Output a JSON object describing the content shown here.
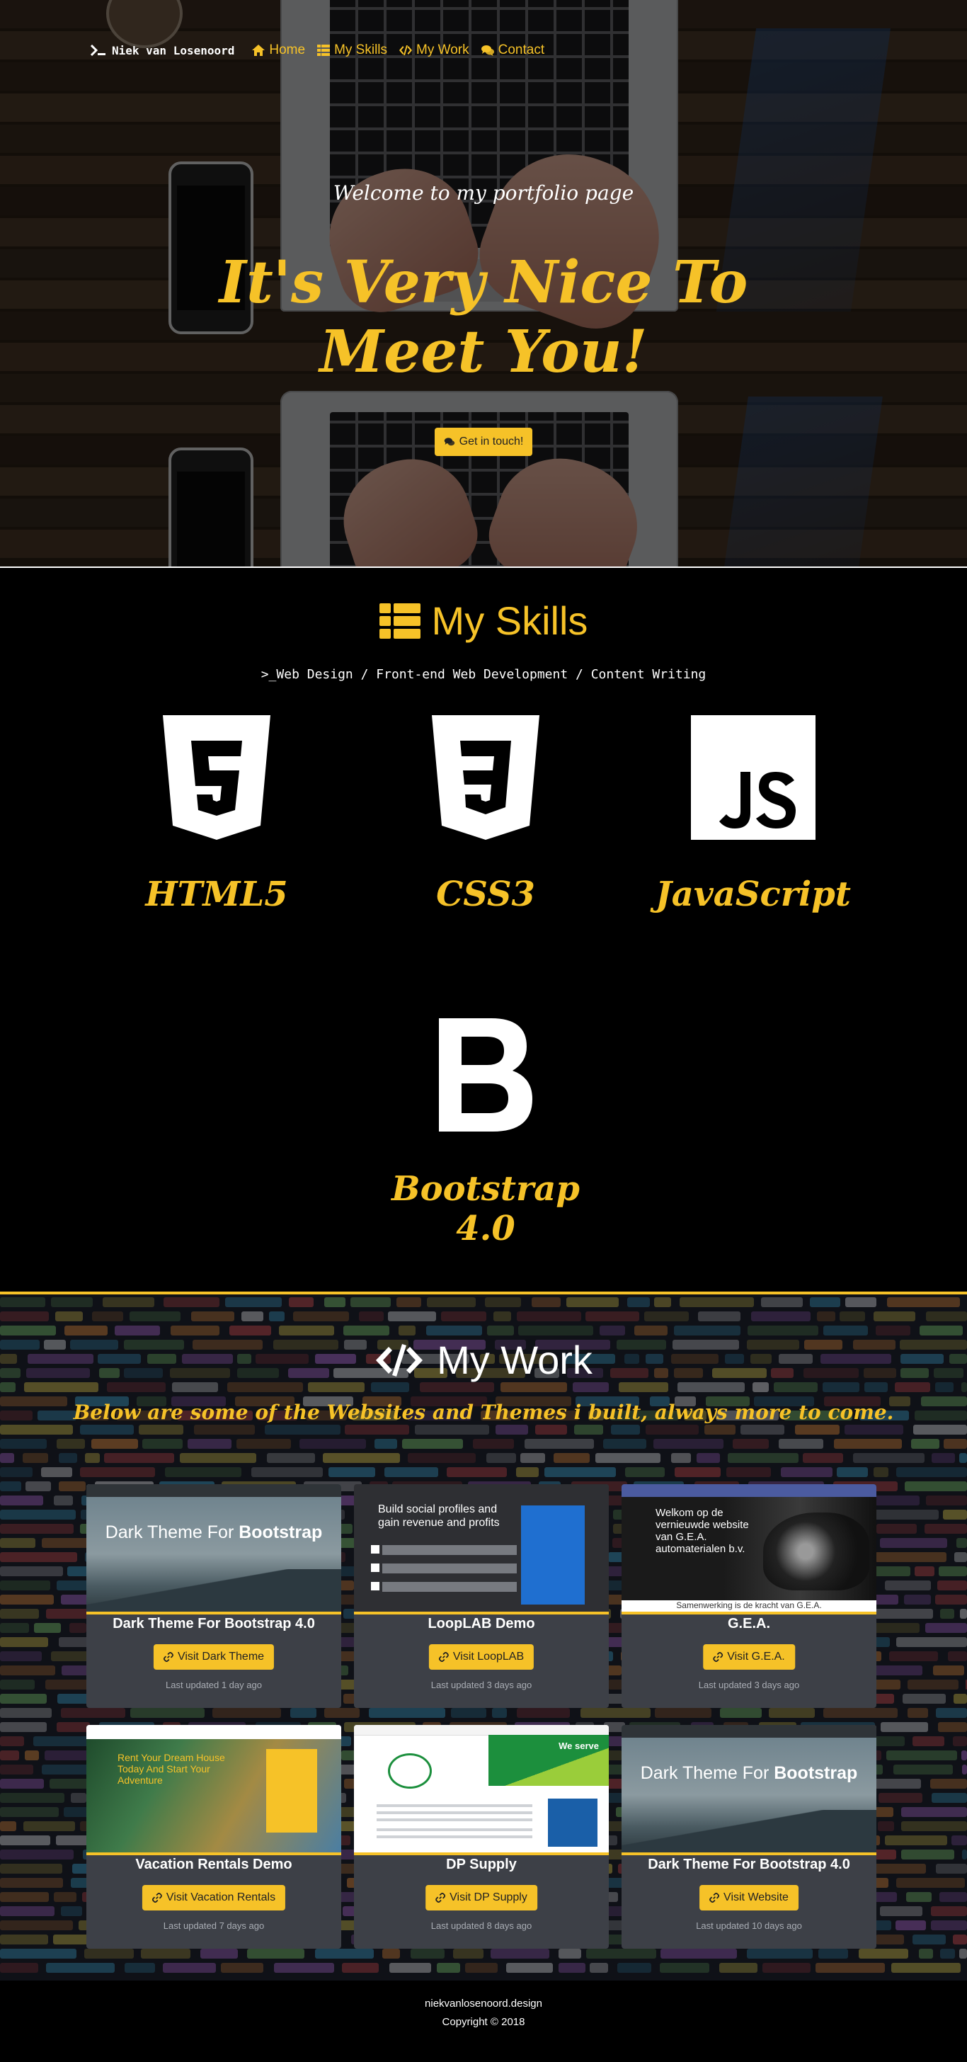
{
  "navbar": {
    "brand": "Niek van Losenoord",
    "links": [
      {
        "label": "Home",
        "icon": "home-icon"
      },
      {
        "label": "My Skills",
        "icon": "list-icon"
      },
      {
        "label": "My Work",
        "icon": "code-icon"
      },
      {
        "label": "Contact",
        "icon": "comments-icon"
      }
    ]
  },
  "hero": {
    "welcome": "Welcome to my portfolio page",
    "title": "It's Very Nice To Meet You!",
    "cta_label": "Get in touch!"
  },
  "skills": {
    "title": "My Skills",
    "subtitle": ">_Web Design / Front-end Web Development / Content Writing",
    "items": [
      {
        "name": "HTML5",
        "icon": "html5-icon"
      },
      {
        "name": "CSS3",
        "icon": "css3-icon"
      },
      {
        "name": "JavaScript",
        "icon": "javascript-icon"
      },
      {
        "name": "Bootstrap 4.0",
        "icon": "bootstrap-icon"
      }
    ]
  },
  "work": {
    "title": "My Work",
    "subtitle": "Below are some of the Websites and Themes i built, always more to come.",
    "projects": [
      {
        "title": "Dark Theme For Bootstrap 4.0",
        "button": "Visit Dark Theme",
        "updated": "Last updated 1 day ago",
        "thumb_heading_light": "Dark",
        "thumb_heading_rest": " Theme For ",
        "thumb_heading_bold": "Bootstrap"
      },
      {
        "title": "LoopLAB Demo",
        "button": "Visit LoopLAB",
        "updated": "Last updated 3 days ago",
        "thumb_text": "Build social profiles and gain revenue and profits"
      },
      {
        "title": "G.E.A.",
        "button": "Visit G.E.A.",
        "updated": "Last updated 3 days ago",
        "thumb_text": "Welkom op de vernieuwde website van G.E.A. automaterialen b.v.",
        "thumb_footer": "Samenwerking is de kracht van G.E.A."
      },
      {
        "title": "Vacation Rentals Demo",
        "button": "Visit Vacation Rentals",
        "updated": "Last updated 7 days ago",
        "thumb_text": "Rent Your Dream House Today And Start Your Adventure"
      },
      {
        "title": "DP Supply",
        "button": "Visit DP Supply",
        "updated": "Last updated 8 days ago",
        "thumb_text": "We serve"
      },
      {
        "title": "Dark Theme For Bootstrap 4.0",
        "button": "Visit Website",
        "updated": "Last updated 10 days ago",
        "thumb_heading_light": "Dark",
        "thumb_heading_rest": " Theme For ",
        "thumb_heading_bold": "Bootstrap"
      }
    ]
  },
  "footer": {
    "domain": "niekvanlosenoord.design",
    "copyright": "Copyright © 2018"
  },
  "colors": {
    "accent": "#f6c228",
    "background": "#000000",
    "card": "#3d4047"
  }
}
